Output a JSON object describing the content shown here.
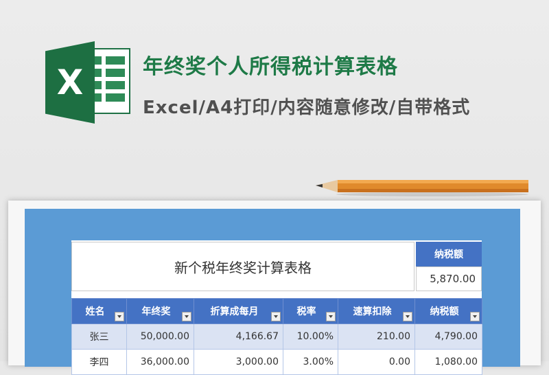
{
  "header": {
    "title": "年终奖个人所得税计算表格",
    "subtitle": "Excel/A4打印/内容随意修改/自带格式",
    "logo_letter": "X",
    "logo_icon": "excel-logo-icon"
  },
  "sheet": {
    "title": "新个税年终奖计算表格",
    "total_tax_label": "纳税额",
    "total_tax_value": "5,870.00",
    "columns": [
      "姓名",
      "年终奖",
      "折算成每月",
      "税率",
      "速算扣除",
      "纳税额"
    ],
    "rows": [
      [
        "张三",
        "50,000.00",
        "4,166.67",
        "10.00%",
        "210.00",
        "4,790.00"
      ],
      [
        "李四",
        "36,000.00",
        "3,000.00",
        "3.00%",
        "0.00",
        "1,080.00"
      ]
    ]
  },
  "colors": {
    "title_green": "#1e7a47",
    "excel_green": "#1d6f42",
    "panel_blue": "#5b9bd5",
    "header_blue": "#4472c4",
    "row_tint": "#dbe3f3"
  }
}
